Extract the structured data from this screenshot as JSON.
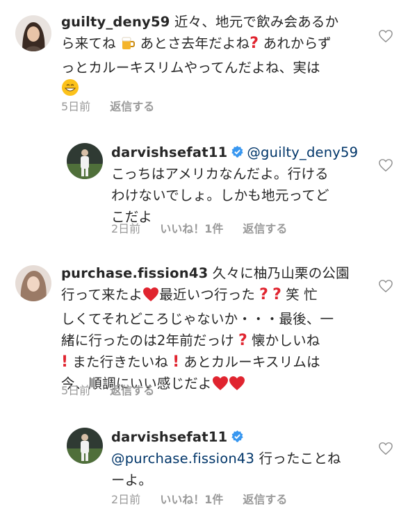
{
  "comments": [
    {
      "username": "guilty_deny59",
      "text_line1": " 近々、地元で飲み会あるか",
      "text_line2a": "ら来てね",
      "text_line2b": "あとさ去年だよね",
      "text_line2c": "あれからず",
      "text_line3": "っとカルーキスリムやってんだよね、実は",
      "time": "5日前",
      "reply_label": "返信する"
    },
    {
      "username": "darvishsefat11",
      "mention": "@guilty_deny59",
      "text_line1": "こっちはアメリカなんだよ。行ける",
      "text_line2": "わけないでしょ。しかも地元ってど",
      "text_line3": "こだよ",
      "time": "2日前",
      "likes_label": "いいね！1件",
      "reply_label": "返信する"
    },
    {
      "username": "purchase.fission43",
      "text_line1": " 久々に柚乃山栗の公園",
      "text_line2a": "行って来たよ",
      "text_line2b": "最近いつ行った",
      "text_line2c": "笑 忙",
      "text_line3": "しくてそれどころじゃないか・・・最後、一",
      "text_line4a": "緒に行ったのは2年前だっけ",
      "text_line4b": "懐かしいね",
      "text_line5a": "また行きたいね",
      "text_line5b": "あとカルーキスリムは",
      "text_line6": "今、順調にいい感じだよ",
      "time": "5日前",
      "reply_label": "返信する"
    },
    {
      "username": "darvishsefat11",
      "mention": "@purchase.fission43",
      "text_line1": " 行ったことね",
      "text_line2": "ーよ。",
      "time": "2日前",
      "likes_label": "いいね！1件",
      "reply_label": "返信する"
    }
  ],
  "icons": {
    "heart": "heart-outline-icon",
    "verified": "verified-badge-icon",
    "beer": "beer-mug-icon",
    "question": "red-question-mark-icon",
    "exclaim": "red-exclamation-mark-icon",
    "grin": "grinning-face-icon",
    "red_heart": "red-heart-icon"
  },
  "colors": {
    "text": "#262626",
    "meta": "#999999",
    "mention": "#003569",
    "verified": "#3897f0",
    "accent_red": "#e0242f"
  }
}
